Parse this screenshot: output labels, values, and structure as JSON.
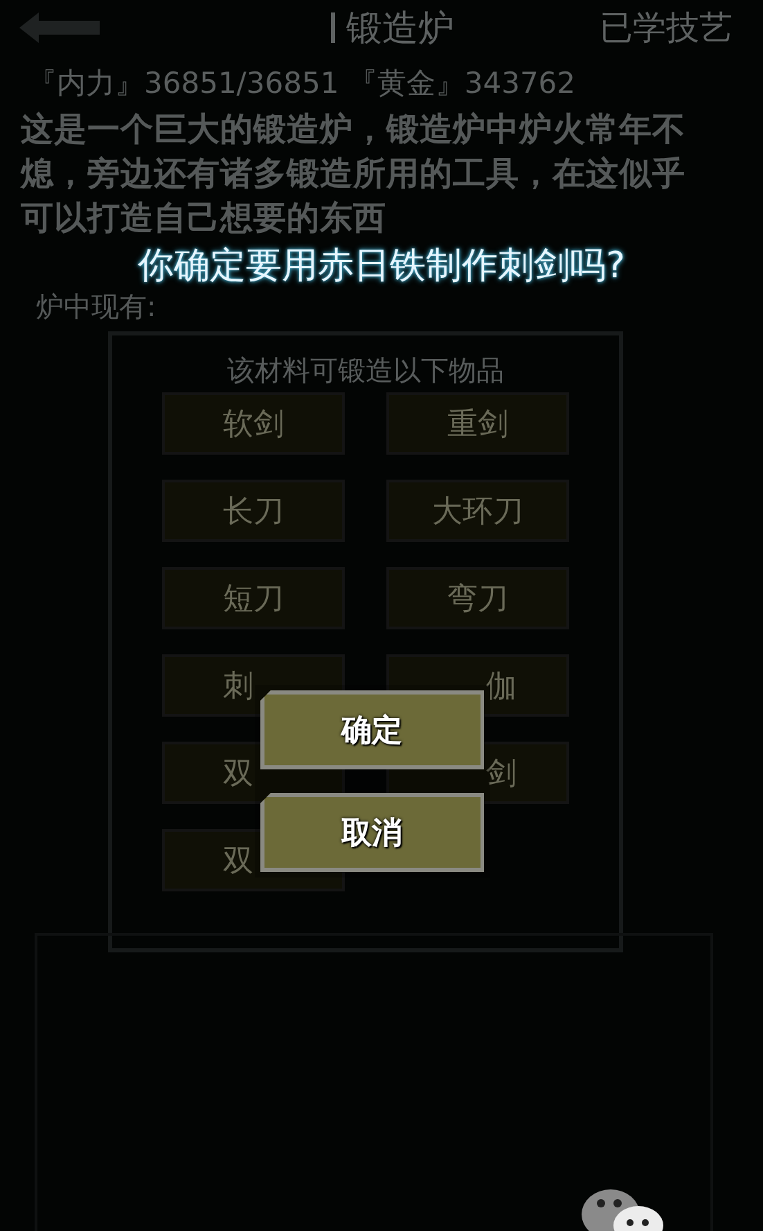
{
  "top_bar": {
    "title": "锻造炉",
    "right_link": "已学技艺"
  },
  "stats": "『内力』36851/36851 『黄金』343762",
  "description": "这是一个巨大的锻造炉，锻造炉中炉火常年不熄，旁边还有诸多锻造所用的工具，在这似乎可以打造自己想要的东西",
  "furnace_label": "炉中现有:",
  "forge_panel": {
    "title": "该材料可锻造以下物品",
    "items": [
      {
        "name": "软剑"
      },
      {
        "name": "重剑"
      },
      {
        "name": "长刀"
      },
      {
        "name": "大环刀"
      },
      {
        "name": "短刀"
      },
      {
        "name": "弯刀"
      },
      {
        "name": "刺",
        "kind": "tailcut"
      },
      {
        "name": "伽",
        "kind": "headcut"
      },
      {
        "name": "双",
        "kind": "tailcut"
      },
      {
        "name": "剑",
        "kind": "headcut"
      },
      {
        "name": "双",
        "kind": "tailcut"
      }
    ]
  },
  "dialog": {
    "question": "你确定要用赤日铁制作刺剑吗?",
    "buttons": [
      {
        "label": "确定"
      },
      {
        "label": "取消"
      }
    ]
  }
}
